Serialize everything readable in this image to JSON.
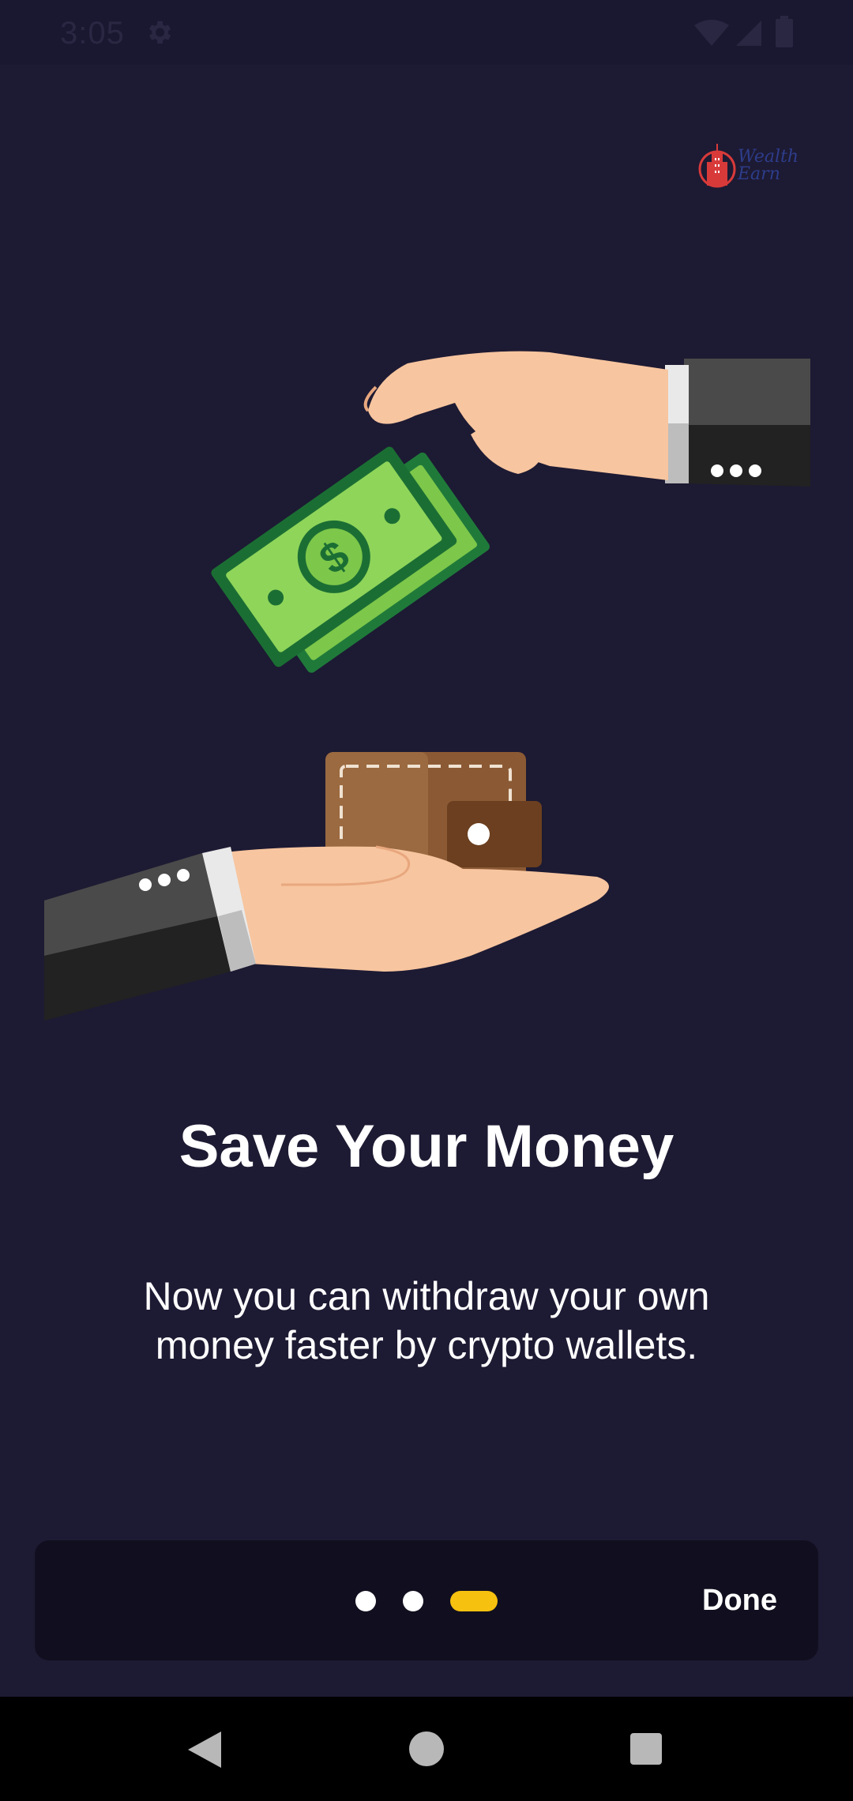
{
  "status_bar": {
    "time": "3:05",
    "icons": [
      "settings-icon",
      "wifi-icon",
      "signal-icon",
      "battery-icon"
    ]
  },
  "logo": {
    "line1": "Wealth",
    "line2": "Earn",
    "color": "#2d3d8a",
    "icon_color": "#d83a3a"
  },
  "onboarding": {
    "title": "Save Your Money",
    "description": "Now you can withdraw your own money faster by crypto wallets.",
    "page_indicator": {
      "total": 3,
      "current": 3
    },
    "done_label": "Done"
  },
  "colors": {
    "background": "#1d1a33",
    "card": "#110f1f",
    "accent": "#f7c10f",
    "text": "#ffffff"
  },
  "nav_bar": {
    "icons": [
      "back-icon",
      "home-icon",
      "recents-icon"
    ]
  }
}
